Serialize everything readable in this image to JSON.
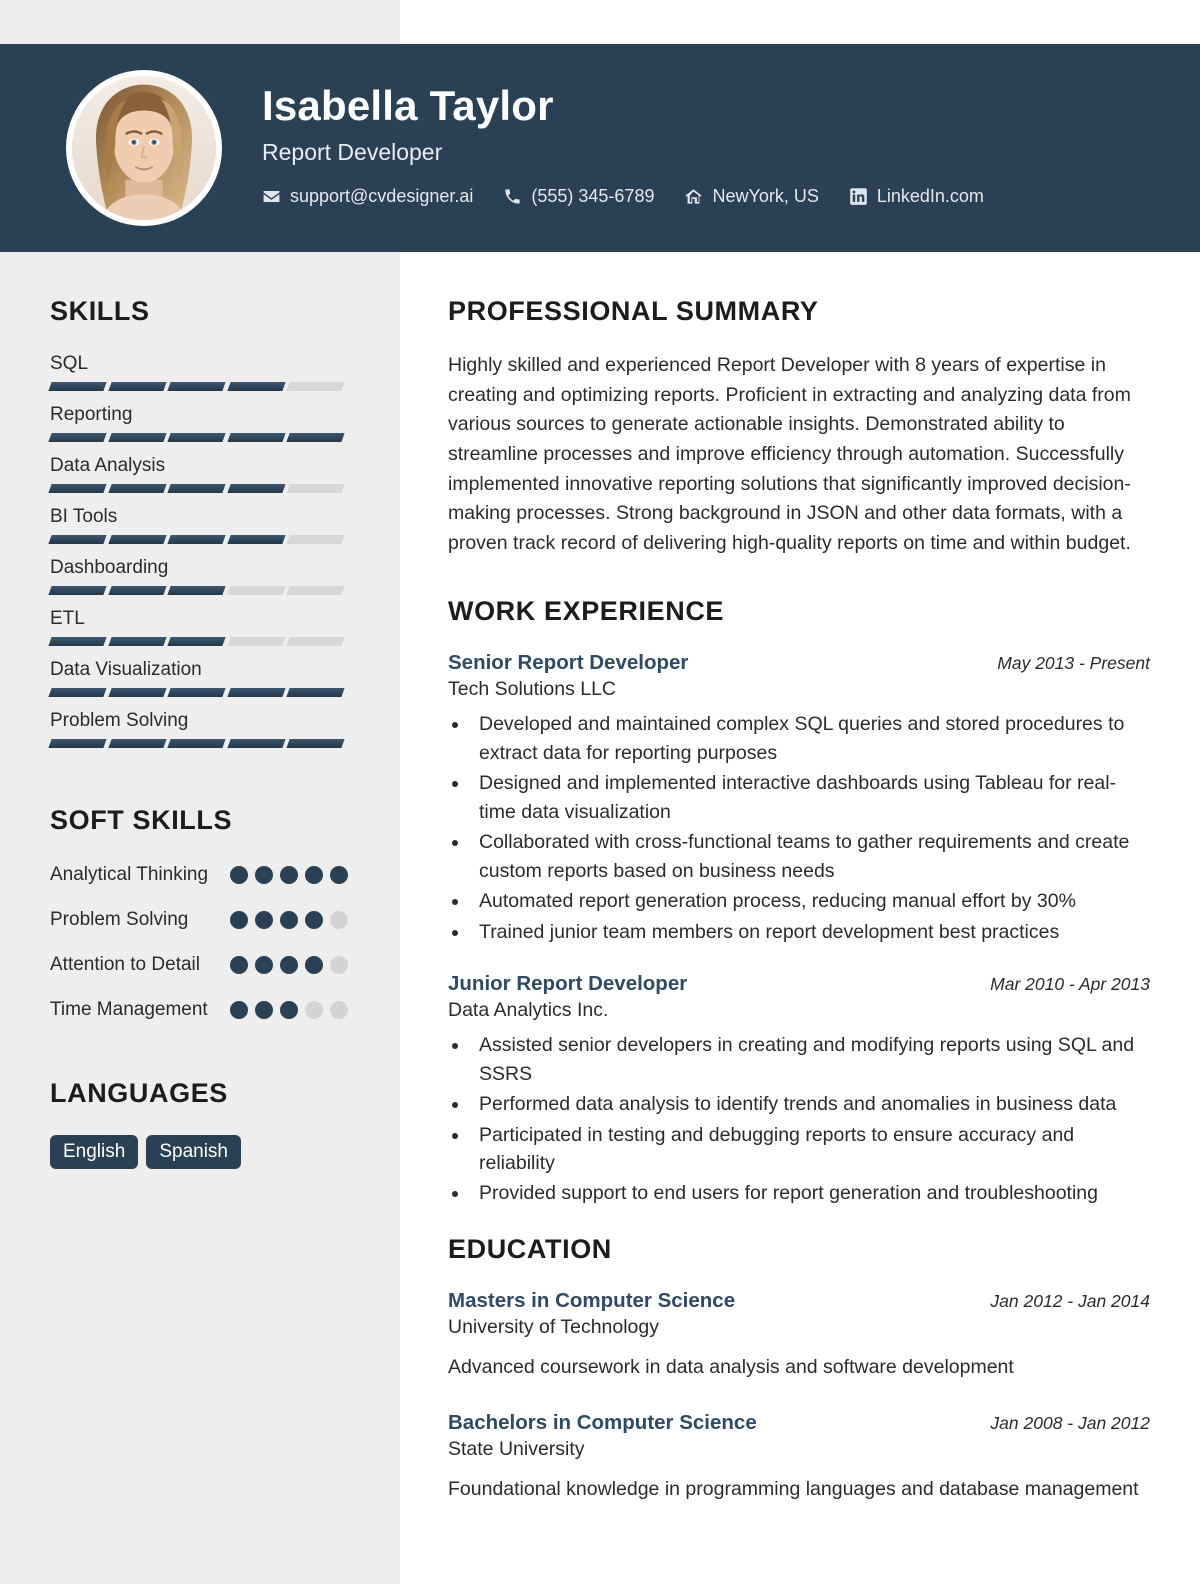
{
  "theme": {
    "header_bg": "#2a4055",
    "sidebar_bg": "#efeeee",
    "accent": "#2e4a66",
    "bar_on": "#2d4259",
    "bar_off": "#d7d7d7",
    "text": "#2b2b2b"
  },
  "header": {
    "name": "Isabella Taylor",
    "role": "Report Developer",
    "contacts": [
      {
        "icon": "envelope-icon",
        "value": "support@cvdesigner.ai"
      },
      {
        "icon": "phone-icon",
        "value": "(555) 345-6789"
      },
      {
        "icon": "home-icon",
        "value": "NewYork, US"
      },
      {
        "icon": "linkedin-icon",
        "value": "LinkedIn.com"
      }
    ]
  },
  "sidebar": {
    "skills_title": "SKILLS",
    "skills": [
      {
        "name": "SQL",
        "level": 4,
        "max": 5
      },
      {
        "name": "Reporting",
        "level": 5,
        "max": 5
      },
      {
        "name": "Data Analysis",
        "level": 4,
        "max": 5
      },
      {
        "name": "BI Tools",
        "level": 4,
        "max": 5
      },
      {
        "name": "Dashboarding",
        "level": 3,
        "max": 5
      },
      {
        "name": "ETL",
        "level": 3,
        "max": 5
      },
      {
        "name": "Data Visualization",
        "level": 5,
        "max": 5
      },
      {
        "name": "Problem Solving",
        "level": 5,
        "max": 5
      }
    ],
    "soft_skills_title": "SOFT SKILLS",
    "soft_skills": [
      {
        "name": "Analytical Thinking",
        "level": 5,
        "max": 5
      },
      {
        "name": "Problem Solving",
        "level": 4,
        "max": 5
      },
      {
        "name": "Attention to Detail",
        "level": 4,
        "max": 5
      },
      {
        "name": "Time Management",
        "level": 3,
        "max": 5
      }
    ],
    "languages_title": "LANGUAGES",
    "languages": [
      "English",
      "Spanish"
    ]
  },
  "main": {
    "summary_title": "PROFESSIONAL SUMMARY",
    "summary_text": "Highly skilled and experienced Report Developer with 8 years of expertise in creating and optimizing reports. Proficient in extracting and analyzing data from various sources to generate actionable insights. Demonstrated ability to streamline processes and improve efficiency through automation. Successfully implemented innovative reporting solutions that significantly improved decision-making processes. Strong background in JSON and other data formats, with a proven track record of delivering high-quality reports on time and within budget.",
    "experience_title": "WORK EXPERIENCE",
    "experience": [
      {
        "title": "Senior Report Developer",
        "date": "May 2013 - Present",
        "org": "Tech Solutions LLC",
        "bullets": [
          "Developed and maintained complex SQL queries and stored procedures to extract data for reporting purposes",
          "Designed and implemented interactive dashboards using Tableau for real-time data visualization",
          "Collaborated with cross-functional teams to gather requirements and create custom reports based on business needs",
          "Automated report generation process, reducing manual effort by 30%",
          "Trained junior team members on report development best practices"
        ]
      },
      {
        "title": "Junior Report Developer",
        "date": "Mar 2010 - Apr 2013",
        "org": "Data Analytics Inc.",
        "bullets": [
          "Assisted senior developers in creating and modifying reports using SQL and SSRS",
          "Performed data analysis to identify trends and anomalies in business data",
          "Participated in testing and debugging reports to ensure accuracy and reliability",
          "Provided support to end users for report generation and troubleshooting"
        ]
      }
    ],
    "education_title": "EDUCATION",
    "education": [
      {
        "degree": "Masters in Computer Science",
        "date": "Jan 2012 - Jan 2014",
        "school": "University of Technology",
        "description": "Advanced coursework in data analysis and software development"
      },
      {
        "degree": "Bachelors in Computer Science",
        "date": "Jan 2008 - Jan 2012",
        "school": "State University",
        "description": "Foundational knowledge in programming languages and database management"
      }
    ]
  }
}
